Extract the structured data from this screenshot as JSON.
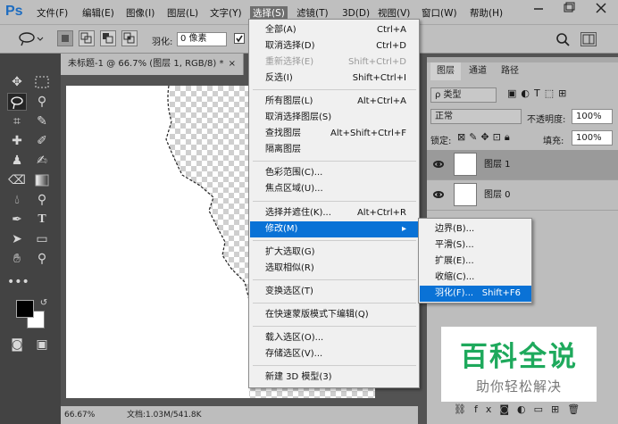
{
  "menubar": {
    "logo": "Ps",
    "items": [
      "文件(F)",
      "编辑(E)",
      "图像(I)",
      "图层(L)",
      "文字(Y)",
      "选择(S)",
      "滤镜(T)",
      "3D(D)",
      "视图(V)",
      "窗口(W)",
      "帮助(H)"
    ]
  },
  "options": {
    "feather_label": "羽化:",
    "feather_value": "0 像素"
  },
  "document": {
    "tab_title": "未标题-1 @ 66.7% (图层 1, RGB/8) *",
    "close": "×"
  },
  "status": {
    "zoom": "66.67%",
    "doc_info": "文档:1.03M/541.8K"
  },
  "select_menu": {
    "items": [
      {
        "label": "全部(A)",
        "shortcut": "Ctrl+A"
      },
      {
        "label": "取消选择(D)",
        "shortcut": "Ctrl+D"
      },
      {
        "label": "重新选择(E)",
        "shortcut": "Shift+Ctrl+D"
      },
      {
        "label": "反选(I)",
        "shortcut": "Shift+Ctrl+I"
      },
      {
        "label": "所有图层(L)",
        "shortcut": "Alt+Ctrl+A"
      },
      {
        "label": "取消选择图层(S)",
        "shortcut": ""
      },
      {
        "label": "查找图层",
        "shortcut": "Alt+Shift+Ctrl+F"
      },
      {
        "label": "隔离图层",
        "shortcut": ""
      },
      {
        "label": "色彩范围(C)...",
        "shortcut": ""
      },
      {
        "label": "焦点区域(U)...",
        "shortcut": ""
      },
      {
        "label": "选择并遮住(K)...",
        "shortcut": "Alt+Ctrl+R"
      },
      {
        "label": "修改(M)",
        "shortcut": ""
      },
      {
        "label": "扩大选取(G)",
        "shortcut": ""
      },
      {
        "label": "选取相似(R)",
        "shortcut": ""
      },
      {
        "label": "变换选区(T)",
        "shortcut": ""
      },
      {
        "label": "在快速蒙版模式下编辑(Q)",
        "shortcut": ""
      },
      {
        "label": "载入选区(O)...",
        "shortcut": ""
      },
      {
        "label": "存储选区(V)...",
        "shortcut": ""
      },
      {
        "label": "新建 3D 模型(3)",
        "shortcut": ""
      }
    ]
  },
  "modify_submenu": {
    "items": [
      {
        "label": "边界(B)...",
        "shortcut": ""
      },
      {
        "label": "平滑(S)...",
        "shortcut": ""
      },
      {
        "label": "扩展(E)...",
        "shortcut": ""
      },
      {
        "label": "收缩(C)...",
        "shortcut": ""
      },
      {
        "label": "羽化(F)...",
        "shortcut": "Shift+F6"
      }
    ]
  },
  "layers_panel": {
    "tabs": [
      "图层",
      "通道",
      "路径"
    ],
    "filter": "ρ 类型",
    "blend_mode": "正常",
    "opacity_label": "不透明度:",
    "opacity_value": "100%",
    "lock_label": "锁定:",
    "fill_label": "填充:",
    "fill_value": "100%",
    "layers": [
      {
        "name": "图层 1"
      },
      {
        "name": "图层 0"
      }
    ]
  },
  "watermark": {
    "title": "百科全说",
    "subtitle": "助你轻松解决"
  },
  "colors": {
    "highlight": "#0a72d6",
    "watermark_green": "#1ea95c",
    "ps_blue": "#1d6cc0"
  }
}
